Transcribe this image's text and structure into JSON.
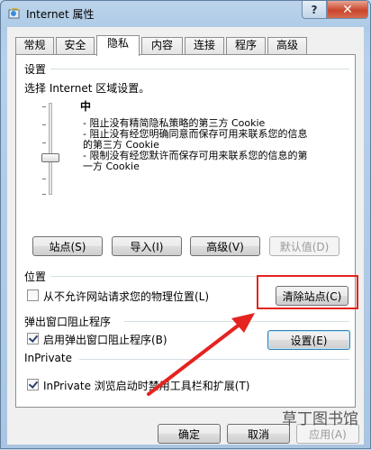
{
  "window": {
    "title": "Internet 属性",
    "help_glyph": "?",
    "close_glyph": "✕"
  },
  "tabs": [
    {
      "label": "常规"
    },
    {
      "label": "安全"
    },
    {
      "label": "隐私"
    },
    {
      "label": "内容"
    },
    {
      "label": "连接"
    },
    {
      "label": "程序"
    },
    {
      "label": "高级"
    }
  ],
  "active_tab": "隐私",
  "settings": {
    "group_title": "设置",
    "prompt": "选择 Internet 区域设置。",
    "level": "中",
    "descriptions": [
      [
        "- 阻止没有精简隐私策略的第三方 Cookie"
      ],
      [
        "- 阻止没有经您明确同意而保存可用来联系您的信息",
        "的第三方 Cookie"
      ],
      [
        "- 限制没有经您默许而保存可用来联系您的信息的第",
        "一方 Cookie"
      ]
    ],
    "buttons": {
      "sites": "站点(S)",
      "import": "导入(I)",
      "advanced": "高级(V)",
      "default": "默认值(D)"
    }
  },
  "location": {
    "group_title": "位置",
    "checkbox_label": "从不允许网站请求您的物理位置(L)",
    "checkbox_checked": false,
    "clear_button": "清除站点(C)"
  },
  "popup": {
    "group_title": "弹出窗口阻止程序",
    "checkbox_label": "启用弹出窗口阻止程序(B)",
    "checkbox_checked": true,
    "settings_button": "设置(E)"
  },
  "inprivate": {
    "group_title": "InPrivate",
    "checkbox_label": "InPrivate 浏览启动时禁用工具栏和扩展(T)",
    "checkbox_checked": true
  },
  "footer": {
    "ok": "确定",
    "cancel": "取消",
    "apply": "应用(A)"
  },
  "watermark": "草丁图书馆",
  "colors": {
    "annotation_red": "#e5231f",
    "title_bar": "#b7d0e9"
  },
  "icons": [
    "ie-globe-icon",
    "help-icon",
    "close-icon"
  ]
}
